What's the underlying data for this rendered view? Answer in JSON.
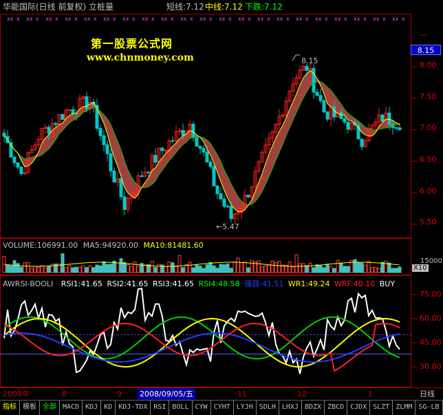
{
  "header": {
    "title": "华能国际(日线 前复权) 立桩量",
    "short_label": "短线:7.12",
    "mid_label": "中线:7.12",
    "fall_label": "下跌:7.12"
  },
  "watermark": {
    "line1": "第一股票公式网",
    "line2": "www.chnmoney.com"
  },
  "price_panel": {
    "current_price_tag": "8.15",
    "y_ticks": [
      "8.00",
      "7.50",
      "7.00",
      "6.50",
      "6.00",
      "5.50"
    ],
    "high_note": "8.15",
    "low_note": "←5.47"
  },
  "volume_panel": {
    "label_volume": "VOLUME:106991.00",
    "label_ma5": "MA5:94920.00",
    "label_ma10": "MA10:81481.60",
    "y_tick": "15000",
    "unit": "X10"
  },
  "indicator_panel": {
    "name": "AWRSI-BOOLI",
    "rsi1": "RSI1:41.65",
    "rsi2": "RSI2:41.65",
    "rsi3": "RSI3:41.65",
    "rsi4": "RSI4:48.58",
    "qiangruo": "强弱:41.51",
    "wr1": "WR1:49.24",
    "wrf": "WRF:40.10",
    "signal": "BUY",
    "y_ticks": [
      "75.00",
      "60.00",
      "45.00",
      "30.00"
    ]
  },
  "date_axis": {
    "labels": [
      "2008年",
      "8",
      "9",
      "2008/09/05/五",
      "11",
      "12",
      "1"
    ],
    "period": "日线"
  },
  "tabs": [
    "指标",
    "模板",
    "全部",
    "MACD",
    "KDJ",
    "KD",
    "KDJ-TDX",
    "RSI",
    "BOLL",
    "CYW",
    "CYHT",
    "LYJH",
    "SDLH",
    "LHXJ",
    "BDZX",
    "ZBCD",
    "CJDX",
    "SLZT",
    "ZLMM",
    "SG-LB"
  ],
  "colors": {
    "frame": "#a00000",
    "up": "#ff2020",
    "down": "#00c8c8",
    "band": "#a04040"
  }
}
